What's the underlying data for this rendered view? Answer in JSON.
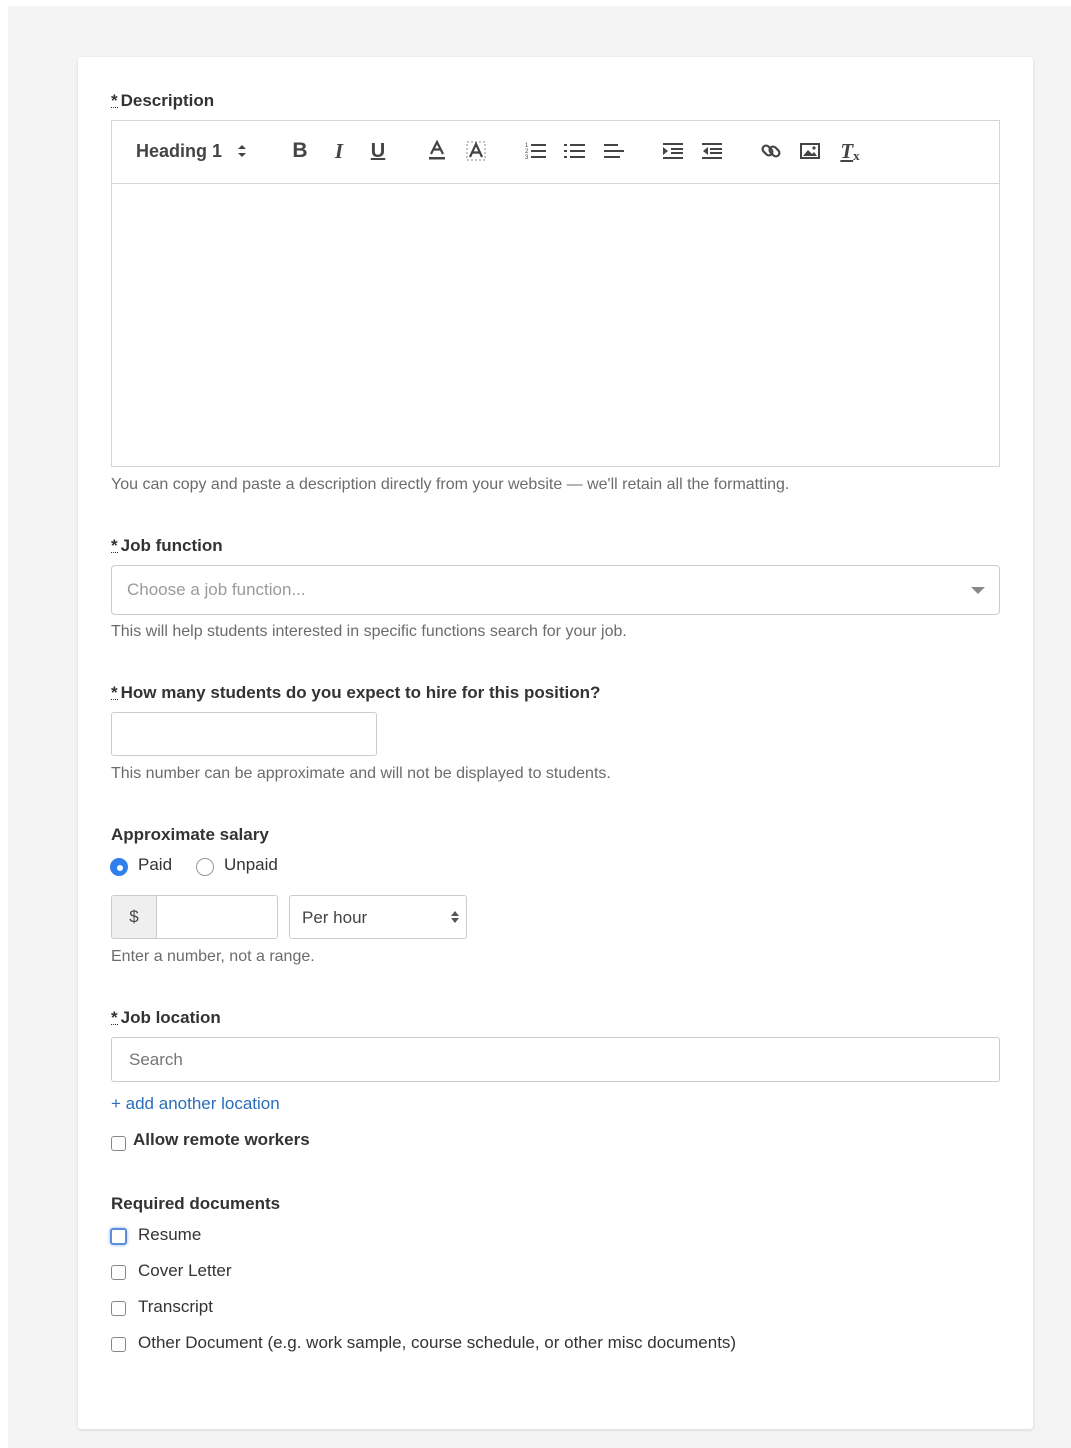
{
  "description": {
    "label": "Description",
    "required_mark": "*",
    "heading_select": "Heading 1",
    "hint": "You can copy and paste a description directly from your website — we'll retain all the formatting."
  },
  "job_function": {
    "label": "Job function",
    "required_mark": "*",
    "placeholder": "Choose a job function...",
    "hint": "This will help students interested in specific functions search for your job."
  },
  "students": {
    "label": "How many students do you expect to hire for this position?",
    "required_mark": "*",
    "value": "",
    "hint": "This number can be approximate and will not be displayed to students."
  },
  "salary": {
    "label": "Approximate salary",
    "paid_label": "Paid",
    "unpaid_label": "Unpaid",
    "selected": "Paid",
    "currency": "$",
    "amount": "",
    "period": "Per hour",
    "hint": "Enter a number, not a range."
  },
  "location": {
    "label": "Job location",
    "required_mark": "*",
    "placeholder": "Search",
    "add_link": "+ add another location",
    "remote_label": "Allow remote workers"
  },
  "documents": {
    "label": "Required documents",
    "items": [
      {
        "label": "Resume",
        "checked": false
      },
      {
        "label": "Cover Letter",
        "checked": false
      },
      {
        "label": "Transcript",
        "checked": false
      },
      {
        "label": "Other Document (e.g. work sample, course schedule, or other misc documents)",
        "checked": false
      }
    ]
  },
  "toolbar_icons": [
    "bold-icon",
    "italic-icon",
    "underline-icon",
    "text-color-icon",
    "background-color-icon",
    "ordered-list-icon",
    "bullet-list-icon",
    "align-icon",
    "indent-icon",
    "outdent-icon",
    "link-icon",
    "image-icon",
    "clear-format-icon"
  ]
}
